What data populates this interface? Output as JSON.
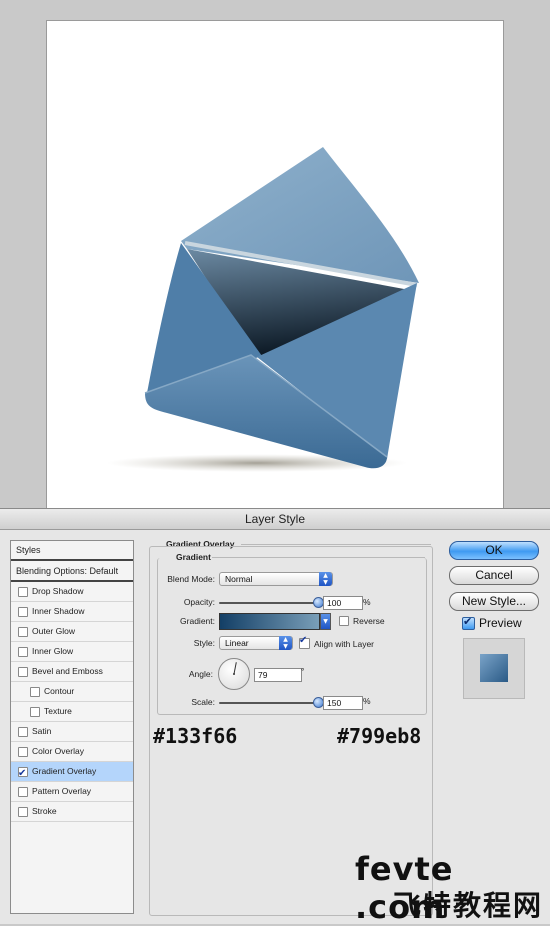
{
  "dialog": {
    "title": "Layer Style"
  },
  "styles_panel": {
    "header": "Styles",
    "blending_options": "Blending Options: Default",
    "items": [
      {
        "label": "Drop Shadow",
        "checked": false,
        "indent": false,
        "selected": false
      },
      {
        "label": "Inner Shadow",
        "checked": false,
        "indent": false,
        "selected": false
      },
      {
        "label": "Outer Glow",
        "checked": false,
        "indent": false,
        "selected": false
      },
      {
        "label": "Inner Glow",
        "checked": false,
        "indent": false,
        "selected": false
      },
      {
        "label": "Bevel and Emboss",
        "checked": false,
        "indent": false,
        "selected": false
      },
      {
        "label": "Contour",
        "checked": false,
        "indent": true,
        "selected": false
      },
      {
        "label": "Texture",
        "checked": false,
        "indent": true,
        "selected": false
      },
      {
        "label": "Satin",
        "checked": false,
        "indent": false,
        "selected": false
      },
      {
        "label": "Color Overlay",
        "checked": false,
        "indent": false,
        "selected": false
      },
      {
        "label": "Gradient Overlay",
        "checked": true,
        "indent": false,
        "selected": true
      },
      {
        "label": "Pattern Overlay",
        "checked": false,
        "indent": false,
        "selected": false
      },
      {
        "label": "Stroke",
        "checked": false,
        "indent": false,
        "selected": false
      }
    ]
  },
  "gradient_overlay": {
    "section_title": "Gradient Overlay",
    "group_title": "Gradient",
    "blend_mode_label": "Blend Mode:",
    "blend_mode_value": "Normal",
    "opacity_label": "Opacity:",
    "opacity_value": "100",
    "opacity_unit": "%",
    "opacity_fraction": 1.0,
    "gradient_label": "Gradient:",
    "gradient_start": "#133f66",
    "gradient_end": "#799eb8",
    "reverse_label": "Reverse",
    "reverse_checked": false,
    "style_label": "Style:",
    "style_value": "Linear",
    "align_label": "Align with Layer",
    "align_checked": true,
    "angle_label": "Angle:",
    "angle_value": "79",
    "angle_unit": "°",
    "angle_degrees": 79,
    "scale_label": "Scale:",
    "scale_value": "150",
    "scale_unit": "%",
    "scale_fraction": 1.0
  },
  "hex_labels": {
    "start": "#133f66",
    "end": "#799eb8"
  },
  "buttons": {
    "ok": "OK",
    "cancel": "Cancel",
    "new_style": "New Style...",
    "preview": "Preview"
  },
  "preview_checked": true,
  "watermark": {
    "line1": "fevte .com",
    "line2": "飞特教程网"
  }
}
